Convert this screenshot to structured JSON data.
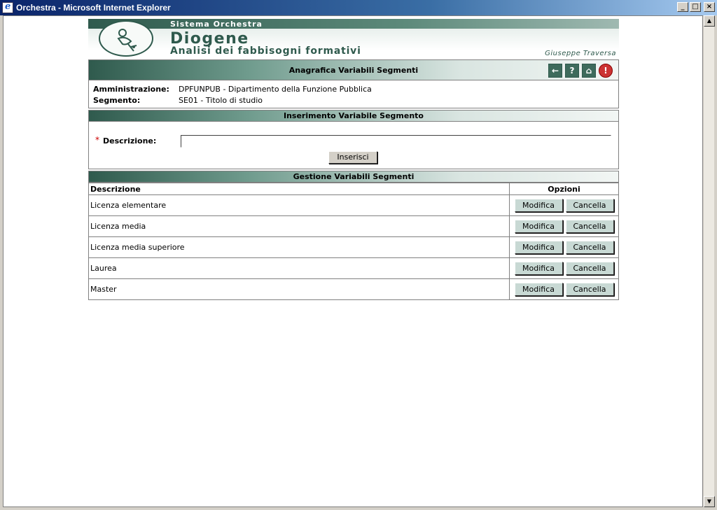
{
  "window": {
    "title": "Orchestra - Microsoft Internet Explorer"
  },
  "banner": {
    "system": "Sistema Orchestra",
    "app_name": "Diogene",
    "subtitle": "Analisi dei fabbisogni formativi",
    "user": "Giuseppe Traversa"
  },
  "header": {
    "title": "Anagrafica Variabili Segmenti",
    "icons": [
      "back-arrow-icon",
      "help-icon",
      "home-icon",
      "exit-icon"
    ]
  },
  "info": {
    "amministrazione_label": "Amministrazione:",
    "amministrazione_value": "DPFUNPUB - Dipartimento della Funzione Pubblica",
    "segmento_label": "Segmento:",
    "segmento_value": "SE01 - Titolo di studio"
  },
  "insert": {
    "section_title": "Inserimento Variabile Segmento",
    "required_mark": "*",
    "label": "Descrizione:",
    "value": "",
    "button": "Inserisci"
  },
  "manage": {
    "section_title": "Gestione Variabili Segmenti",
    "col_desc": "Descrizione",
    "col_opts": "Opzioni",
    "edit_label": "Modifica",
    "delete_label": "Cancella",
    "rows": [
      {
        "descrizione": "Licenza elementare"
      },
      {
        "descrizione": "Licenza media"
      },
      {
        "descrizione": "Licenza media superiore"
      },
      {
        "descrizione": "Laurea"
      },
      {
        "descrizione": "Master"
      }
    ]
  },
  "colors": {
    "theme": "#2f5a4d",
    "required": "#cc0000",
    "button_face": "#c8d9d4"
  }
}
